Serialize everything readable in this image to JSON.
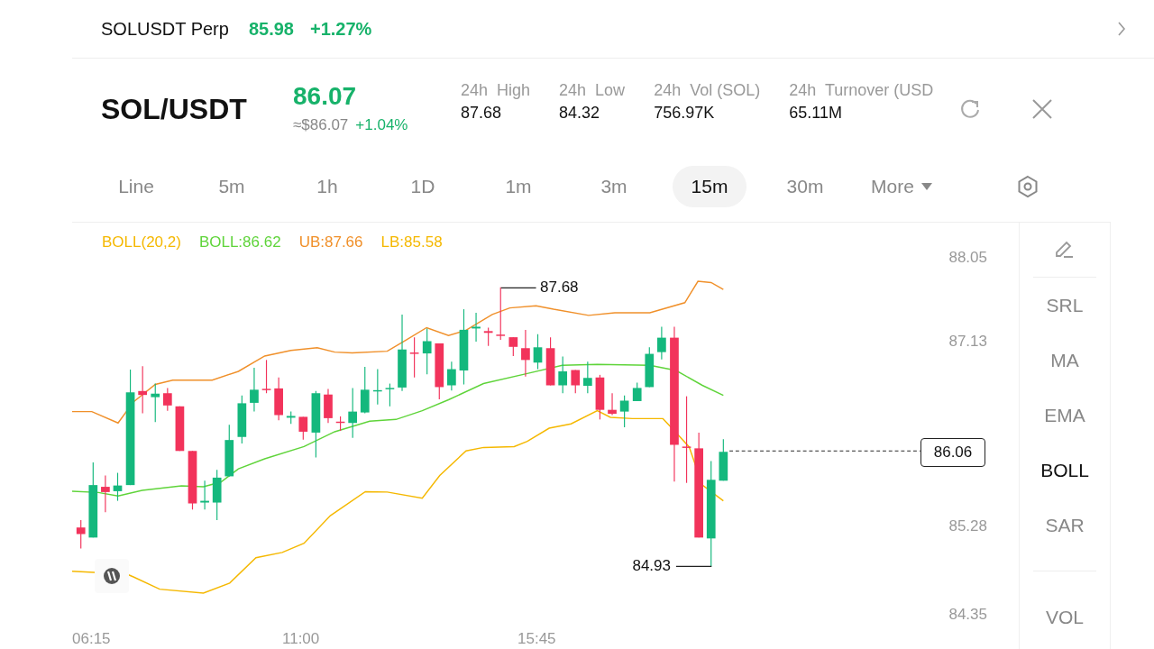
{
  "ticker": {
    "symbol": "SOLUSDT Perp",
    "price": "85.98",
    "change": "+1.27%"
  },
  "header": {
    "pair": "SOL/USDT",
    "price": "86.07",
    "fiat_price": "≈$86.07",
    "change": "+1.04%",
    "stats": [
      {
        "label": "24h  High",
        "value": "87.68"
      },
      {
        "label": "24h  Low",
        "value": "84.32"
      },
      {
        "label": "24h  Vol (SOL)",
        "value": "756.97K"
      },
      {
        "label": "24h  Turnover (USD",
        "value": "65.11M"
      }
    ]
  },
  "intervals": [
    {
      "label": "Line",
      "selected": false
    },
    {
      "label": "5m",
      "selected": false
    },
    {
      "label": "1h",
      "selected": false
    },
    {
      "label": "1D",
      "selected": false
    },
    {
      "label": "1m",
      "selected": false
    },
    {
      "label": "3m",
      "selected": false
    },
    {
      "label": "15m",
      "selected": true
    },
    {
      "label": "30m",
      "selected": false
    }
  ],
  "more_menu": {
    "label": "More"
  },
  "chart": {
    "legend": [
      {
        "text": "BOLL(20,2)",
        "color": "#f5b800"
      },
      {
        "text": "BOLL:86.62",
        "color": "#5fd43a"
      },
      {
        "text": "UB:87.66",
        "color": "#f0902a"
      },
      {
        "text": "LB:85.58",
        "color": "#f5b800"
      }
    ],
    "y_axis_labels": [
      "88.05",
      "87.13",
      "85.28",
      "84.35"
    ],
    "x_axis_labels": [
      "06:15",
      "11:00",
      "15:45"
    ],
    "high_marker": "87.68",
    "low_marker": "84.93",
    "last_price": "86.06"
  },
  "indicators": [
    {
      "label": "SRL",
      "selected": false
    },
    {
      "label": "MA",
      "selected": false
    },
    {
      "label": "EMA",
      "selected": false
    },
    {
      "label": "BOLL",
      "selected": true
    },
    {
      "label": "SAR",
      "selected": false
    }
  ],
  "sub_indicators": [
    {
      "label": "VOL",
      "selected": false
    }
  ]
}
